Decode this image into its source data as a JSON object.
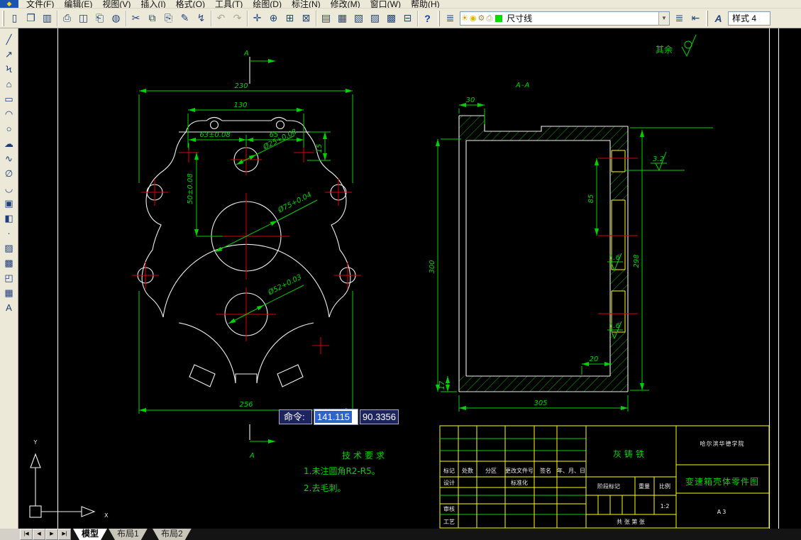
{
  "menu": {
    "items": [
      {
        "name": "file",
        "label": "文件(F)"
      },
      {
        "name": "edit",
        "label": "编辑(E)"
      },
      {
        "name": "view",
        "label": "视图(V)"
      },
      {
        "name": "insert",
        "label": "插入(I)"
      },
      {
        "name": "format",
        "label": "格式(O)"
      },
      {
        "name": "tools",
        "label": "工具(T)"
      },
      {
        "name": "draw",
        "label": "绘图(D)"
      },
      {
        "name": "dimension",
        "label": "标注(N)"
      },
      {
        "name": "modify",
        "label": "修改(M)"
      },
      {
        "name": "window",
        "label": "窗口(W)"
      },
      {
        "name": "help",
        "label": "帮助(H)"
      }
    ]
  },
  "toolbar": {
    "standard": [
      {
        "name": "new",
        "glyph": "▯"
      },
      {
        "name": "open",
        "glyph": "❐"
      },
      {
        "name": "save",
        "glyph": "▥",
        "sep_after": true
      },
      {
        "name": "plot",
        "glyph": "⎙"
      },
      {
        "name": "plot-preview",
        "glyph": "◫"
      },
      {
        "name": "publish",
        "glyph": "⎗"
      },
      {
        "name": "publish-dwf",
        "glyph": "◍",
        "sep_after": true
      },
      {
        "name": "cut",
        "glyph": "✂"
      },
      {
        "name": "copy",
        "glyph": "⧉"
      },
      {
        "name": "paste",
        "glyph": "⎘"
      },
      {
        "name": "match-properties",
        "glyph": "✎"
      },
      {
        "name": "block-editor",
        "glyph": "↯",
        "sep_after": true
      },
      {
        "name": "undo",
        "glyph": "↶",
        "disabled": true
      },
      {
        "name": "redo",
        "glyph": "↷",
        "disabled": true,
        "sep_after": true
      },
      {
        "name": "pan",
        "glyph": "✛"
      },
      {
        "name": "zoom-realtime",
        "glyph": "⊕"
      },
      {
        "name": "zoom-window",
        "glyph": "⊞"
      },
      {
        "name": "zoom-previous",
        "glyph": "⊠",
        "sep_after": true
      },
      {
        "name": "properties",
        "glyph": "▤"
      },
      {
        "name": "designcenter",
        "glyph": "▦"
      },
      {
        "name": "tool-palettes",
        "glyph": "▧"
      },
      {
        "name": "sheet-set-manager",
        "glyph": "▨"
      },
      {
        "name": "markup-set-manager",
        "glyph": "▩"
      },
      {
        "name": "quickcalc",
        "glyph": "⊟",
        "sep_after": true
      },
      {
        "name": "help",
        "glyph": "?"
      }
    ],
    "layers": {
      "layers_button_glyph": "≣",
      "on_glyph": "☀",
      "freeze_glyph": "◉",
      "lock_glyph": "⚙",
      "plot_glyph": "⎙",
      "color_hex": "#00dd00",
      "current_layer": "尺寸线",
      "dropdown_arrow": "▼",
      "make_current_glyph": "≣",
      "previous_glyph": "⇤"
    },
    "styles": {
      "icon_glyph": "A",
      "current_style": "样式 4"
    }
  },
  "draw_palette": [
    {
      "name": "line",
      "glyph": "╱"
    },
    {
      "name": "construction-line",
      "glyph": "↗"
    },
    {
      "name": "polyline",
      "glyph": "Ϟ"
    },
    {
      "name": "polygon",
      "glyph": "⌂"
    },
    {
      "name": "rectangle",
      "glyph": "▭"
    },
    {
      "name": "arc",
      "glyph": "◠"
    },
    {
      "name": "circle",
      "glyph": "○"
    },
    {
      "name": "revision-cloud",
      "glyph": "☁"
    },
    {
      "name": "spline",
      "glyph": "∿"
    },
    {
      "name": "ellipse",
      "glyph": "∅"
    },
    {
      "name": "ellipse-arc",
      "glyph": "◡"
    },
    {
      "name": "insert-block",
      "glyph": "▣"
    },
    {
      "name": "make-block",
      "glyph": "◧"
    },
    {
      "name": "point",
      "glyph": "·"
    },
    {
      "name": "hatch",
      "glyph": "▨"
    },
    {
      "name": "gradient",
      "glyph": "▩"
    },
    {
      "name": "region",
      "glyph": "◰"
    },
    {
      "name": "table",
      "glyph": "▦"
    },
    {
      "name": "text",
      "glyph": "A"
    }
  ],
  "canvas": {
    "surface_note": {
      "prefix": "其余"
    },
    "plan_view": {
      "section_marker": "A",
      "dims": {
        "overall_width": "230",
        "flange_width": "130",
        "hole_left_offset": "63±0.08",
        "hole_right_offset": "65",
        "flange_depth": "15",
        "center_offset": "50±0.08",
        "top_bore": "Ø25+0.08",
        "large_bore": "Ø75+0.04",
        "small_bore": "Ø52+0.03",
        "base_width": "256"
      }
    },
    "section_view": {
      "label": "A-A",
      "dims": {
        "flange_step": "30",
        "overall_height": "300",
        "bore_spacing": "85",
        "wall_height": "298",
        "base_length": "305",
        "lip": "20",
        "floor_thickness": "17",
        "finish_top": "3.2",
        "finish_bore_1": "1.6",
        "finish_bore_2": "1.6"
      }
    },
    "tech_requirements": {
      "title": "技术要求",
      "lines": [
        "1.未注圆角R2-R5。",
        "2.去毛刺。"
      ]
    },
    "ucs": {
      "x_label": "X",
      "y_label": "Y"
    },
    "command_tooltip": {
      "label": "命令:",
      "value": "141.115",
      "value2": "90.3356"
    },
    "title_block": {
      "material": "灰铸铁",
      "organization": "哈尔滨华德学院",
      "drawing_title": "变速箱壳体零件图",
      "scale_value": "1:2",
      "sheet_size": "A3",
      "labels": {
        "mark": "标记",
        "count": "处数",
        "zone": "分区",
        "change_file_no": "更改文件号",
        "signature": "签名",
        "date": "年、月、日",
        "design": "设计",
        "standardization": "标准化",
        "stage_mark": "阶段标记",
        "weight": "重量",
        "scale": "比例",
        "review": "审核",
        "process": "工艺",
        "sheet_note": "共 张 第 张"
      }
    }
  },
  "tabs": {
    "nav": [
      {
        "name": "first",
        "glyph": "|◀"
      },
      {
        "name": "prev",
        "glyph": "◀"
      },
      {
        "name": "next",
        "glyph": "▶"
      },
      {
        "name": "last",
        "glyph": "▶|"
      }
    ],
    "items": [
      {
        "name": "model",
        "label": "模型",
        "active": true
      },
      {
        "name": "layout1",
        "label": "布局1",
        "active": false
      },
      {
        "name": "layout2",
        "label": "布局2",
        "active": false
      }
    ]
  },
  "colors": {
    "dim_green": "#00d200",
    "centerline_red": "#e00000",
    "outline_white": "#efefef",
    "aux_yellow": "#ffff00",
    "ui_gray": "#ece9d8",
    "selection_blue": "#2f64c9",
    "tooltip_navy": "#1e255e"
  }
}
